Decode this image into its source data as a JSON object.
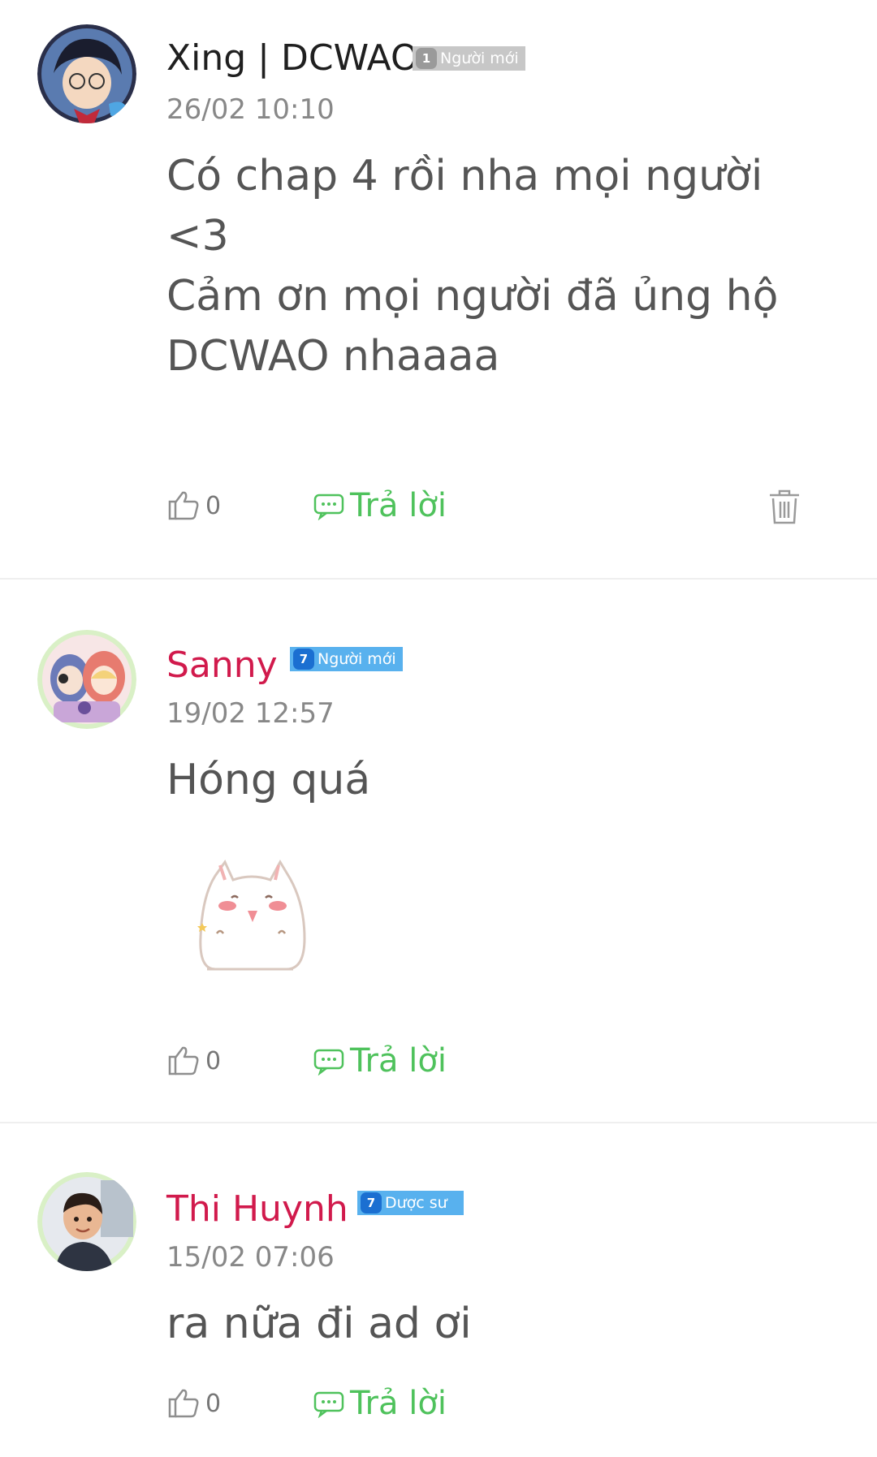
{
  "comments": [
    {
      "username": "Xing | DCWAO",
      "badge_level": "1",
      "badge_label": "Người mới",
      "timestamp": "26/02 10:10",
      "text": "Có chap 4 rồi nha mọi người\n<3\nCảm ơn mọi người đã ủng hộ\nDCWAO nhaaaa",
      "likes": "0",
      "reply_label": "Trả lời",
      "has_delete": true,
      "avatar_icon": "anime-boy-glasses-avatar"
    },
    {
      "username": "Sanny",
      "badge_level": "7",
      "badge_label": "Người mới",
      "timestamp": "19/02 12:57",
      "text": "Hóng quá",
      "sticker_icon": "white-cat-sticker",
      "likes": "0",
      "reply_label": "Trả lời",
      "avatar_icon": "anime-girls-avatar"
    },
    {
      "username": "Thi Huynh",
      "badge_level": "7",
      "badge_label": "Dược sư",
      "timestamp": "15/02 07:06",
      "text": "ra nữa đi ad ơi",
      "likes": "0",
      "reply_label": "Trả lời",
      "avatar_icon": "child-photo-avatar"
    }
  ],
  "colors": {
    "username_dark": "#1f1f1f",
    "username_red": "#d11a4c",
    "reply_green": "#4fc25c",
    "badge_gray": "#c7c7c7",
    "badge_blue": "#58b1ee"
  }
}
